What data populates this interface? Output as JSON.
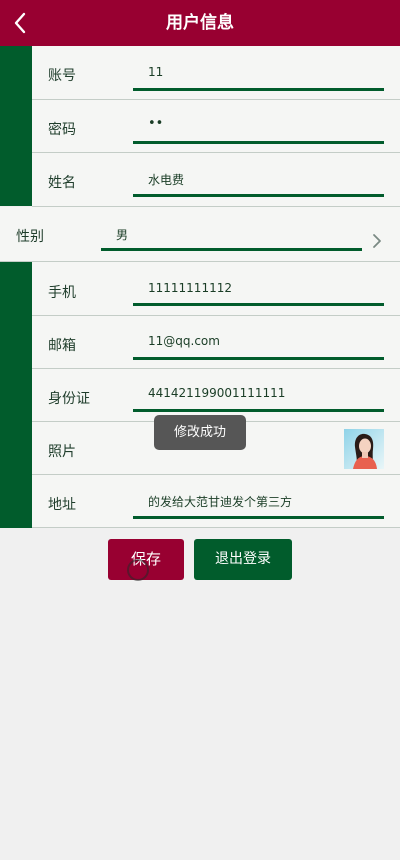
{
  "header": {
    "title": "用户信息",
    "back_icon": "chevron-left-icon"
  },
  "fields": {
    "account": {
      "label": "账号",
      "value": "11"
    },
    "password": {
      "label": "密码",
      "value": "••"
    },
    "name": {
      "label": "姓名",
      "value": "水电费"
    },
    "gender": {
      "label": "性别",
      "value": "男",
      "icon": "chevron-right-icon"
    },
    "phone": {
      "label": "手机",
      "value": "11111111112"
    },
    "email": {
      "label": "邮箱",
      "value": "11@qq.com"
    },
    "id_card": {
      "label": "身份证",
      "value": "441421199001111111"
    },
    "photo": {
      "label": "照片"
    },
    "address": {
      "label": "地址",
      "value": "的发给大范甘迪发个第三方"
    }
  },
  "buttons": {
    "save_label": "保存",
    "logout_label": "退出登录"
  },
  "toast": {
    "text": "修改成功"
  },
  "colors": {
    "primary": "#980031",
    "secondary": "#015c2c",
    "background": "#f0f0f0"
  }
}
